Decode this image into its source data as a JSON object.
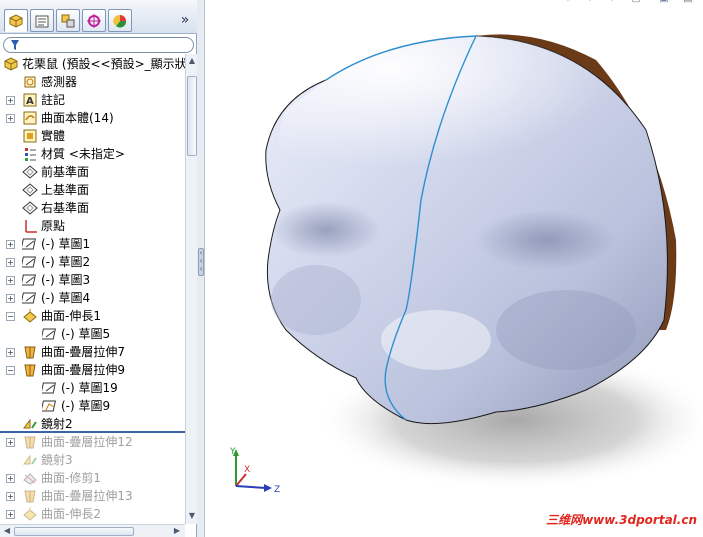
{
  "tabs": [
    {
      "name": "feature-manager",
      "icon": "feature-manager-icon",
      "active": true
    },
    {
      "name": "property-manager",
      "icon": "property-manager-icon",
      "active": false
    },
    {
      "name": "configuration-manager",
      "icon": "configuration-manager-icon",
      "active": false
    },
    {
      "name": "dimxpert-manager",
      "icon": "dimxpert-icon",
      "active": false
    },
    {
      "name": "display-manager",
      "icon": "display-manager-icon",
      "active": false
    }
  ],
  "tabs_expand": "»",
  "filter": {
    "icon": "filter-icon",
    "value": ""
  },
  "tree": {
    "root": {
      "label": "花栗鼠 (預設<<預設>_顯示狀",
      "icon": "part-icon"
    },
    "items": [
      {
        "label": "感測器",
        "icon": "sensor-icon",
        "expander": false
      },
      {
        "label": "註記",
        "icon": "annotation-icon",
        "expander": true
      },
      {
        "label": "曲面本體(14)",
        "icon": "surface-bodies-icon",
        "expander": true
      },
      {
        "label": "實體",
        "icon": "solid-bodies-icon",
        "expander": false
      },
      {
        "label": "材質 <未指定>",
        "icon": "material-icon",
        "expander": false
      },
      {
        "label": "前基準面",
        "icon": "plane-icon",
        "expander": false
      },
      {
        "label": "上基準面",
        "icon": "plane-icon",
        "expander": false
      },
      {
        "label": "右基準面",
        "icon": "plane-icon",
        "expander": false
      },
      {
        "label": "原點",
        "icon": "origin-icon",
        "expander": false
      },
      {
        "label": "(-) 草圖1",
        "icon": "sketch-icon",
        "expander": true
      },
      {
        "label": "(-) 草圖2",
        "icon": "sketch-icon",
        "expander": true
      },
      {
        "label": "(-) 草圖3",
        "icon": "sketch-icon",
        "expander": true
      },
      {
        "label": "(-) 草圖4",
        "icon": "sketch-icon",
        "expander": true
      },
      {
        "label": "曲面-伸長1",
        "icon": "surface-extrude-icon",
        "expander": true,
        "expanded": true
      },
      {
        "label": "(-) 草圖5",
        "icon": "sketch-icon",
        "expander": false,
        "child": true
      },
      {
        "label": "曲面-疊層拉伸7",
        "icon": "surface-loft-icon",
        "expander": true
      },
      {
        "label": "曲面-疊層拉伸9",
        "icon": "surface-loft-icon",
        "expander": true,
        "expanded": true
      },
      {
        "label": "(-) 草圖19",
        "icon": "sketch-icon",
        "expander": false,
        "child": true
      },
      {
        "label": "(-) 草圖9",
        "icon": "sketch-3d-icon",
        "expander": false,
        "child": true
      },
      {
        "label": "鏡射2",
        "icon": "mirror-icon",
        "expander": false
      },
      {
        "label": "曲面-疊層拉伸12",
        "icon": "surface-loft-icon",
        "expander": true,
        "dim": true
      },
      {
        "label": "鏡射3",
        "icon": "mirror-icon",
        "expander": false,
        "dim": true
      },
      {
        "label": "曲面-修剪1",
        "icon": "surface-trim-icon",
        "expander": true,
        "dim": true
      },
      {
        "label": "曲面-疊層拉伸13",
        "icon": "surface-loft-icon",
        "expander": true,
        "dim": true
      },
      {
        "label": "曲面-伸長2",
        "icon": "surface-extrude-icon",
        "expander": true,
        "dim": true
      }
    ]
  },
  "triad": {
    "x_label": "X",
    "y_label": "Y",
    "z_label": "Z"
  },
  "watermark": "三维网www.3dportal.cn",
  "colors": {
    "model_surface": "#c9d0e6",
    "model_edge": "#2e8fd0",
    "rollback_bar": "#3c63a8",
    "watermark": "#e0281f"
  }
}
